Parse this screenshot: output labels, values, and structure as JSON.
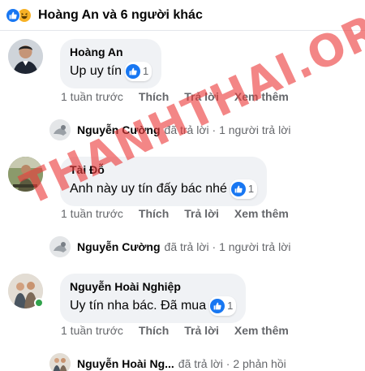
{
  "header": {
    "title": "Hoàng An và 6 người khác",
    "reactions": [
      "like-icon",
      "haha-icon"
    ]
  },
  "comments": [
    {
      "author": "Hoàng An",
      "text": "Up uy tín",
      "reaction_count": "1",
      "time": "1 tuần trước",
      "like_label": "Thích",
      "reply_label": "Trả lời",
      "more_label": "Xem thêm",
      "reply_preview": {
        "name": "Nguyễn Cường",
        "meta": "đã trả lời · 1 người trả lời"
      }
    },
    {
      "author": "Tài Đỗ",
      "text": "Anh này uy tín đấy bác nhé",
      "reaction_count": "1",
      "time": "1 tuần trước",
      "like_label": "Thích",
      "reply_label": "Trả lời",
      "more_label": "Xem thêm",
      "reply_preview": {
        "name": "Nguyễn Cường",
        "meta": "đã trả lời · 1 người trả lời"
      }
    },
    {
      "author": "Nguyễn Hoài Nghiệp",
      "text": "Uy tín nha bác. Đã mua",
      "reaction_count": "1",
      "time": "1 tuần trước",
      "like_label": "Thích",
      "reply_label": "Trả lời",
      "more_label": "Xem thêm",
      "reply_preview": {
        "name": "Nguyễn Hoài Ng...",
        "meta": "đã trả lời · 2 phản hồi"
      }
    }
  ],
  "watermark": "THANHTHAI.ORG",
  "colors": {
    "like": "#1877f2",
    "haha": "#f7b125",
    "online": "#31a24c",
    "watermark": "#ec3c3c"
  }
}
